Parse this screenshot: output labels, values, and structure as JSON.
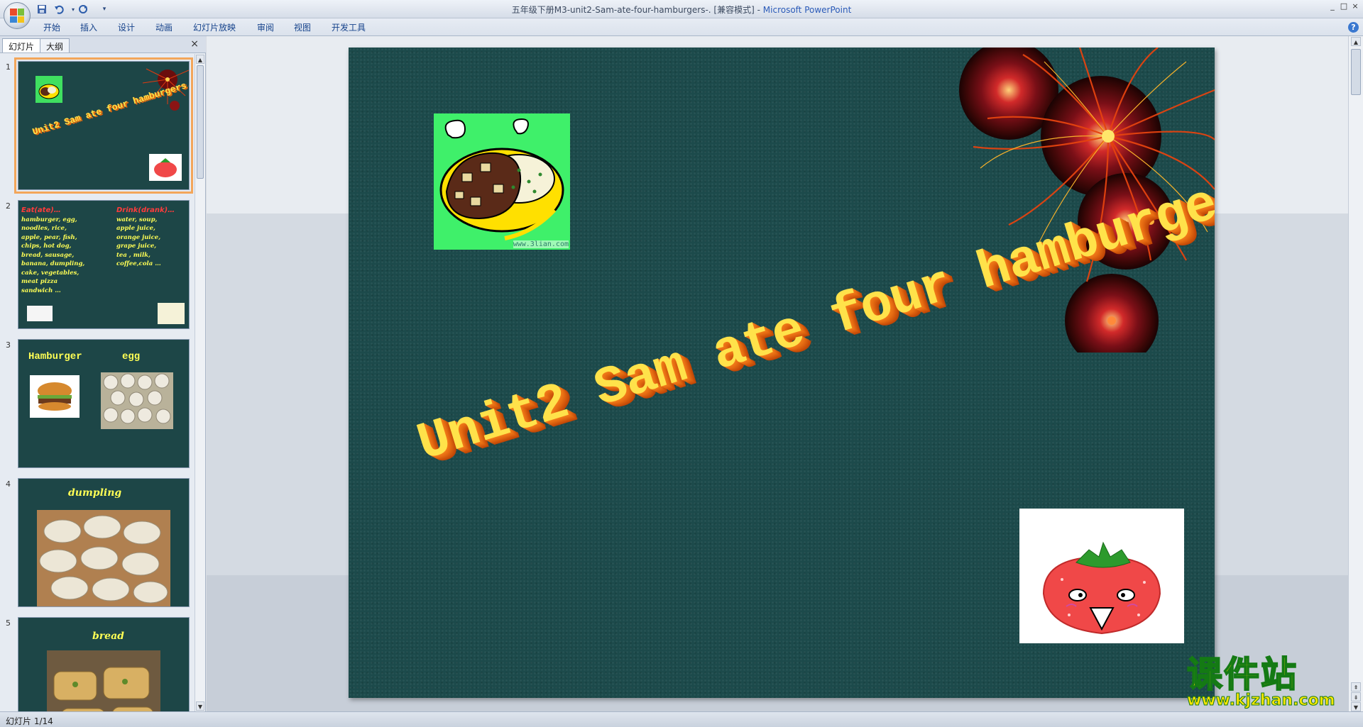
{
  "window": {
    "title": "五年级下册M3-unit2-Sam-ate-four-hamburgers-. [兼容模式]",
    "app_name": "Microsoft PowerPoint",
    "controls": [
      "_",
      "□",
      "×"
    ]
  },
  "quick_access": {
    "icons": [
      "save-icon",
      "undo-icon",
      "redo-icon",
      "customize-icon"
    ]
  },
  "ribbon": {
    "tabs": [
      "开始",
      "插入",
      "设计",
      "动画",
      "幻灯片放映",
      "审阅",
      "视图",
      "开发工具"
    ],
    "help": "?"
  },
  "left_pane": {
    "tabs": [
      "幻灯片",
      "大纲"
    ],
    "close": "×",
    "slides": [
      {
        "num": "1",
        "title": "Unit2 Sam ate four hamburgers."
      },
      {
        "num": "2",
        "eat_head": "Eat(ate)…",
        "eat_lines": [
          "hamburger, egg,",
          "noodles, rice,",
          "apple, pear, fish,",
          "chips, hot dog,",
          "bread, sausage,",
          "banana, dumpling,",
          "cake, vegetables,",
          "meat pizza",
          "sandwich …"
        ],
        "drink_head": "Drink(drank)…",
        "drink_lines": [
          "water, soup,",
          "apple juice,",
          "orange juice,",
          "grape juice,",
          "tea , milk,",
          "coffee,cola …"
        ]
      },
      {
        "num": "3",
        "word1": "Hamburger",
        "word2": "egg"
      },
      {
        "num": "4",
        "word": "dumpling"
      },
      {
        "num": "5",
        "word": "bread"
      }
    ]
  },
  "slide": {
    "title": "Unit2 Sam ate four hamburgers.",
    "image_caption": "www.3lian.com"
  },
  "status": {
    "text": "幻灯片 1/14"
  },
  "watermark": {
    "brand": "课件站",
    "url": "www.kjzhan.com"
  },
  "colors": {
    "slide_bg": "#1c4a4b",
    "title_fill": "#ffe24a",
    "title_extrude": "#e06a10",
    "thumb_yellow": "#ffff55",
    "thumb_red": "#ff3b3b",
    "selection": "#f3a65a"
  }
}
